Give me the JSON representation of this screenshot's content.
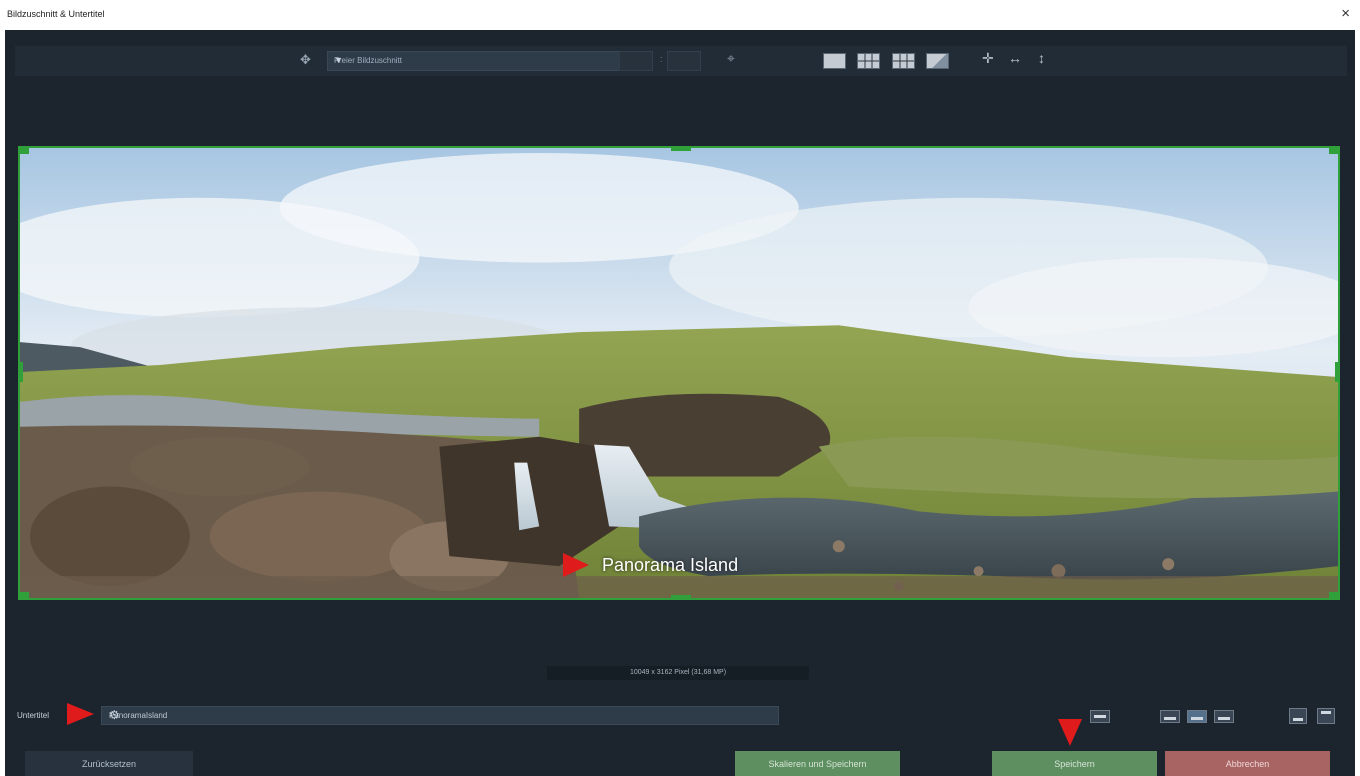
{
  "window": {
    "title": "Bildzuschnitt & Untertitel",
    "close_glyph": "×"
  },
  "toolbar": {
    "aspect_icon": "crop-ratio-icon",
    "aspect_value": "Freier Bildzuschnitt",
    "dim_separator": ":",
    "center_icon": "center-target-icon",
    "grid_layouts": [
      "single-grid",
      "thirds-grid",
      "fine-grid",
      "diagonal-grid"
    ],
    "align_icons": [
      "crosshair-icon",
      "horizontal-fit-icon",
      "vertical-fit-icon"
    ]
  },
  "preview": {
    "caption": "Panorama Island",
    "handle_color": "#2fa03a"
  },
  "status": {
    "info": "10049 x 3162 Pixel (31,68 MP)"
  },
  "subtitle": {
    "label": "Untertitel",
    "value": "PanoramaIsland",
    "options_icon": "gear-icon"
  },
  "buttons": {
    "reset": "Zurücksetzen",
    "scale_save": "Skalieren und Speichern",
    "save": "Speichern",
    "cancel": "Abbrechen"
  },
  "colors": {
    "dialog_bg": "#1c252e",
    "accent_green": "#5e8f60",
    "cancel_red": "#a86463",
    "marker_red": "#e01b1b"
  }
}
